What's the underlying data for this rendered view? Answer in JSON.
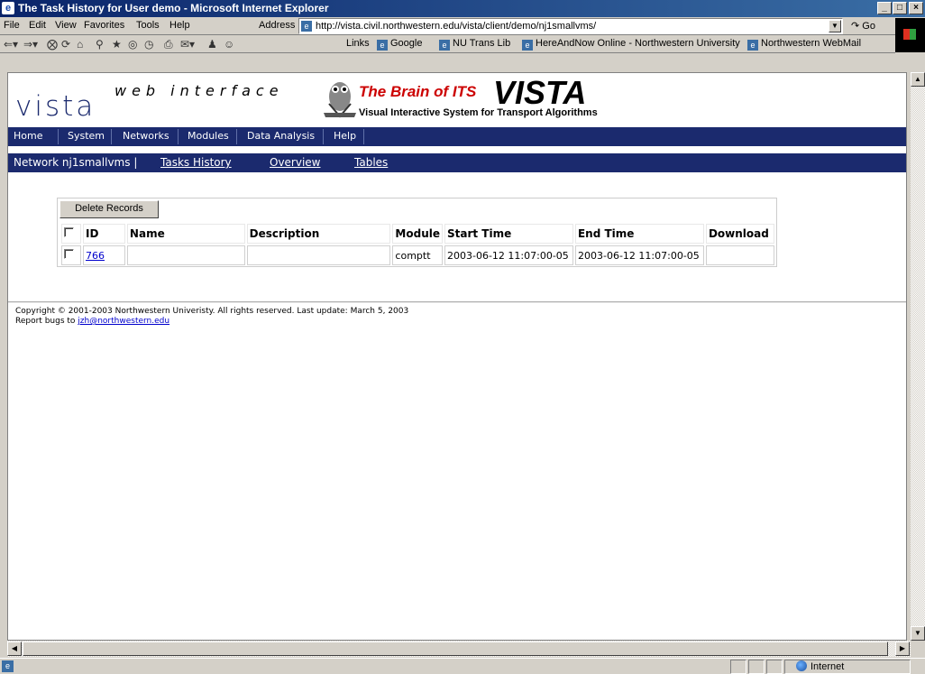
{
  "window": {
    "title": "The Task History for User demo - Microsoft Internet Explorer",
    "min": "_",
    "max": "□",
    "close": "×"
  },
  "menu": [
    "File",
    "Edit",
    "View",
    "Favorites",
    "Tools",
    "Help"
  ],
  "address": {
    "label": "Address",
    "url": "http://vista.civil.northwestern.edu/vista/client/demo/nj1smallvms/",
    "go": "Go"
  },
  "links": {
    "label": "Links",
    "items": [
      "Google",
      "NU Trans Lib",
      "HereAndNow Online - Northwestern University",
      "Northwestern WebMail"
    ],
    "chevron": "»"
  },
  "site": {
    "logo_left": "vista",
    "logo_tag": "web interface",
    "brain": "The Brain of ITS",
    "vista": "VISTA",
    "subtitle": "Visual Interactive System for Transport Algorithms"
  },
  "nav": [
    "Home",
    "System",
    "Networks",
    "Modules",
    "Data Analysis",
    "Help"
  ],
  "subnav": {
    "network": "Network nj1smallvms |",
    "links": [
      "Tasks History",
      "Overview",
      "Tables"
    ]
  },
  "table": {
    "delete_label": "Delete Records",
    "headers": [
      "ID",
      "Name",
      "Description",
      "Module",
      "Start Time",
      "End Time",
      "Download"
    ],
    "rows": [
      {
        "id": "766",
        "name": "",
        "description": "",
        "module": "comptt",
        "start": "2003-06-12 11:07:00-05",
        "end": "2003-06-12 11:07:00-05",
        "download": ""
      }
    ]
  },
  "footer": {
    "copyright": "Copyright © 2001-2003 Northwestern Univeristy. All rights reserved. Last update: March 5, 2003",
    "bugs_prefix": "Report bugs to ",
    "bugs_email": "jzh@northwestern.edu"
  },
  "status": {
    "zone": "Internet"
  },
  "colors": {
    "nav_bg": "#1b2a6e",
    "brain_red": "#cc0000",
    "link": "#0000cc"
  }
}
